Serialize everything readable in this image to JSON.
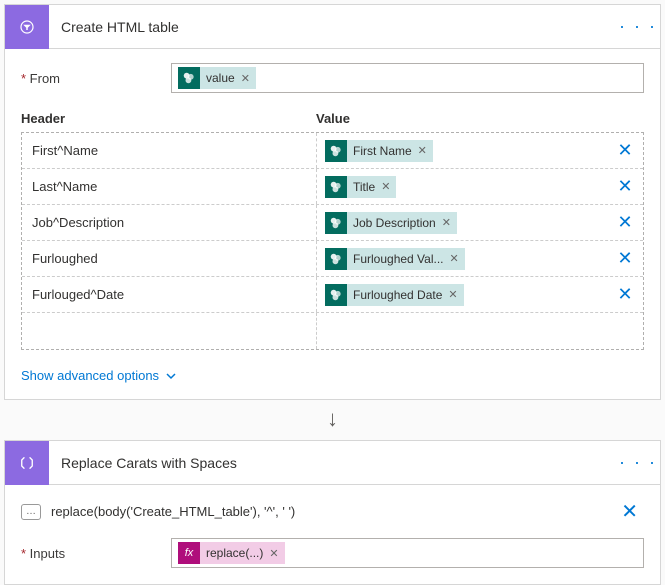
{
  "card1": {
    "title": "Create HTML table",
    "fromLabel": "From",
    "fromChip": "value",
    "headerCol": "Header",
    "valueCol": "Value",
    "rows": [
      {
        "header": "First^Name",
        "value": "First Name"
      },
      {
        "header": "Last^Name",
        "value": "Title"
      },
      {
        "header": "Job^Description",
        "value": "Job Description"
      },
      {
        "header": "Furloughed",
        "value": "Furloughed Val..."
      },
      {
        "header": "Furlouged^Date",
        "value": "Furloughed Date"
      }
    ],
    "advanced": "Show advanced options"
  },
  "card2": {
    "title": "Replace Carats with Spaces",
    "expression": "replace(body('Create_HTML_table'), '^', ' ')",
    "inputsLabel": "Inputs",
    "fxChip": "replace(...)",
    "fxBadge": "fx"
  },
  "glyphs": {
    "chipX": "✕",
    "rowX": "✕",
    "exprDots": "…",
    "arrow": "↓",
    "menu": "· · ·"
  }
}
